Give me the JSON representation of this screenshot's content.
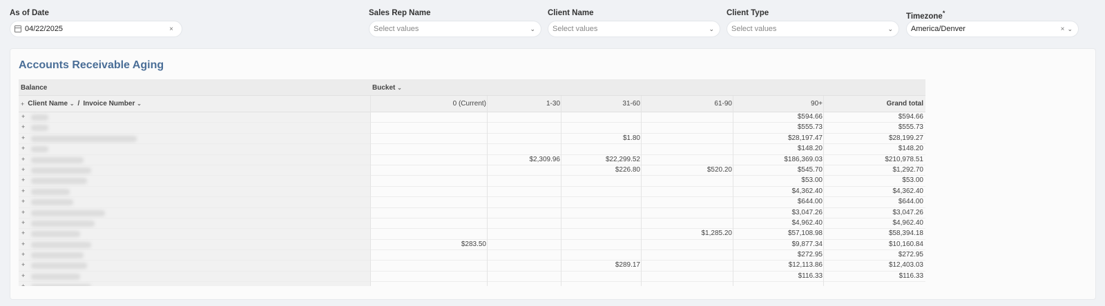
{
  "filters": [
    {
      "label": "As of Date",
      "value": "04/22/2025",
      "placeholder": "",
      "calendar_icon": true,
      "clearable": true,
      "dropdown": false,
      "required": false
    },
    {
      "label": "Sales Rep Name",
      "value": "",
      "placeholder": "Select values",
      "calendar_icon": false,
      "clearable": false,
      "dropdown": true,
      "required": false
    },
    {
      "label": "Client Name",
      "value": "",
      "placeholder": "Select values",
      "calendar_icon": false,
      "clearable": false,
      "dropdown": true,
      "required": false
    },
    {
      "label": "Client Type",
      "value": "",
      "placeholder": "Select values",
      "calendar_icon": false,
      "clearable": false,
      "dropdown": true,
      "required": false
    },
    {
      "label": "Timezone",
      "value": "America/Denver",
      "placeholder": "",
      "calendar_icon": false,
      "clearable": true,
      "dropdown": true,
      "required": true
    }
  ],
  "report": {
    "title": "Accounts Receivable Aging",
    "header": {
      "measure_label": "Balance",
      "pivot_label": "Bucket",
      "row_fields": [
        "Client Name",
        "Invoice Number"
      ],
      "row_separator": "/",
      "columns": [
        "0 (Current)",
        "1-30",
        "31-60",
        "61-90",
        "90+",
        "Grand total"
      ]
    },
    "rows": [
      {
        "blur_width": 0.05,
        "values": [
          "",
          "",
          "",
          "",
          "$594.66",
          "$594.66"
        ]
      },
      {
        "blur_width": 0.05,
        "values": [
          "",
          "",
          "",
          "",
          "$555.73",
          "$555.73"
        ]
      },
      {
        "blur_width": 0.3,
        "values": [
          "",
          "",
          "$1.80",
          "",
          "$28,197.47",
          "$28,199.27"
        ]
      },
      {
        "blur_width": 0.05,
        "values": [
          "",
          "",
          "",
          "",
          "$148.20",
          "$148.20"
        ]
      },
      {
        "blur_width": 0.15,
        "values": [
          "",
          "$2,309.96",
          "$22,299.52",
          "",
          "$186,369.03",
          "$210,978.51"
        ]
      },
      {
        "blur_width": 0.17,
        "values": [
          "",
          "",
          "$226.80",
          "$520.20",
          "$545.70",
          "$1,292.70"
        ]
      },
      {
        "blur_width": 0.16,
        "values": [
          "",
          "",
          "",
          "",
          "$53.00",
          "$53.00"
        ]
      },
      {
        "blur_width": 0.11,
        "values": [
          "",
          "",
          "",
          "",
          "$4,362.40",
          "$4,362.40"
        ]
      },
      {
        "blur_width": 0.12,
        "values": [
          "",
          "",
          "",
          "",
          "$644.00",
          "$644.00"
        ]
      },
      {
        "blur_width": 0.21,
        "values": [
          "",
          "",
          "",
          "",
          "$3,047.26",
          "$3,047.26"
        ]
      },
      {
        "blur_width": 0.18,
        "values": [
          "",
          "",
          "",
          "",
          "$4,962.40",
          "$4,962.40"
        ]
      },
      {
        "blur_width": 0.14,
        "values": [
          "",
          "",
          "",
          "$1,285.20",
          "$57,108.98",
          "$58,394.18"
        ]
      },
      {
        "blur_width": 0.17,
        "values": [
          "$283.50",
          "",
          "",
          "",
          "$9,877.34",
          "$10,160.84"
        ]
      },
      {
        "blur_width": 0.15,
        "values": [
          "",
          "",
          "",
          "",
          "$272.95",
          "$272.95"
        ]
      },
      {
        "blur_width": 0.16,
        "values": [
          "",
          "",
          "$289.17",
          "",
          "$12,113.86",
          "$12,403.03"
        ]
      },
      {
        "blur_width": 0.14,
        "values": [
          "",
          "",
          "",
          "",
          "$116.33",
          "$116.33"
        ]
      },
      {
        "blur_width": 0.17,
        "values": [
          "",
          "",
          "",
          "",
          "",
          ""
        ]
      }
    ]
  }
}
